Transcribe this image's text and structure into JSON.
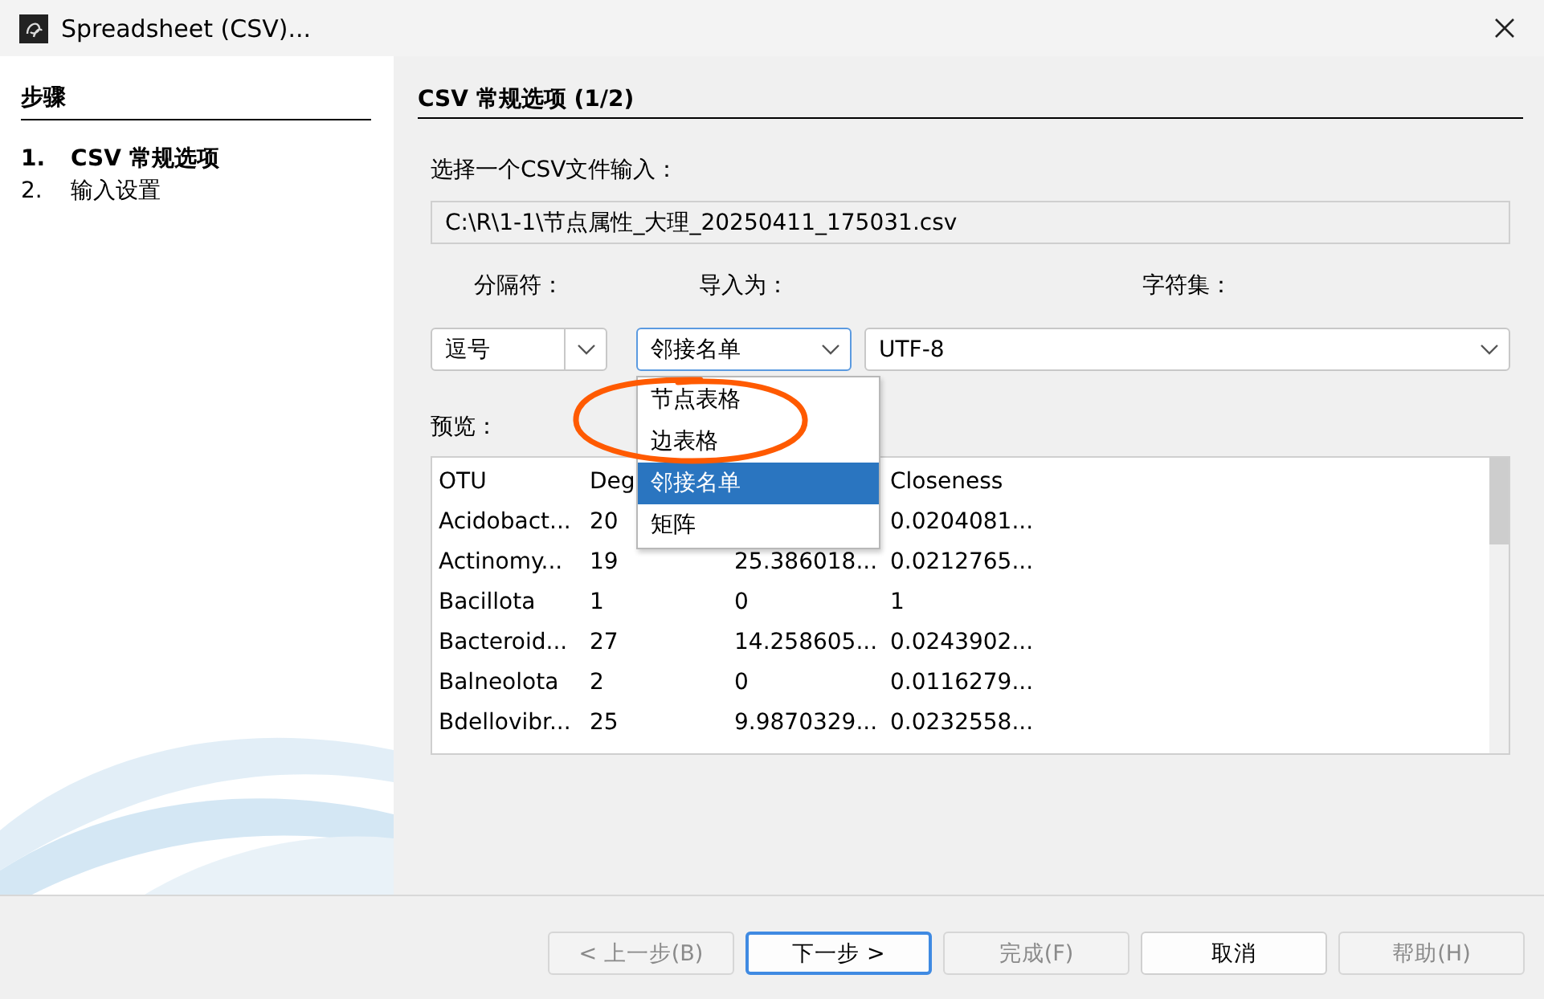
{
  "window": {
    "title": "Spreadsheet (CSV)..."
  },
  "steps": {
    "heading": "步骤",
    "items": [
      {
        "number": "1.",
        "label": "CSV 常规选项",
        "selected": true
      },
      {
        "number": "2.",
        "label": "输入设置",
        "selected": false
      }
    ]
  },
  "page": {
    "heading": "CSV 常规选项 (1/2)",
    "file_label": "选择一个CSV文件输入：",
    "file_path": "C:\\R\\1-1\\节点属性_大理_20250411_175031.csv"
  },
  "options": [
    {
      "kind": "split",
      "label": "分隔符：",
      "value": "逗号",
      "focused": false
    },
    {
      "kind": "plain",
      "label": "导入为：",
      "value": "邻接名单",
      "focused": true
    },
    {
      "kind": "plain",
      "label": "字符集：",
      "value": "UTF-8",
      "focused": false
    }
  ],
  "import_menu": {
    "open": true,
    "items": [
      {
        "label": "节点表格",
        "selected": false
      },
      {
        "label": "边表格",
        "selected": false
      },
      {
        "label": "邻接名单",
        "selected": true
      },
      {
        "label": "矩阵",
        "selected": false
      }
    ]
  },
  "preview": {
    "label": "预览：",
    "columns": [
      "OTU",
      "Deg",
      null,
      "Closeness"
    ],
    "rows": [
      [
        "Acidobact...",
        "20",
        null,
        "0.0204081..."
      ],
      [
        "Actinomy...",
        "19",
        "25.386018...",
        "0.0212765..."
      ],
      [
        "Bacillota",
        "1",
        "0",
        "1"
      ],
      [
        "Bacteroid...",
        "27",
        "14.258605...",
        "0.0243902..."
      ],
      [
        "Balneolota",
        "2",
        "0",
        "0.0116279..."
      ],
      [
        "Bdellovibr...",
        "25",
        "9.9870329...",
        "0.0232558..."
      ]
    ]
  },
  "buttons": [
    {
      "label": "< 上一步(B)",
      "disabled": true,
      "default": false
    },
    {
      "label": "下一步 >",
      "disabled": false,
      "default": true
    },
    {
      "label": "完成(F)",
      "disabled": true,
      "default": false
    },
    {
      "label": "取消",
      "disabled": false,
      "default": false
    },
    {
      "label": "帮助(H)",
      "disabled": true,
      "default": false
    }
  ],
  "annotations": [
    {
      "kind": "freehand-circle",
      "color": "#ff5a00"
    }
  ]
}
